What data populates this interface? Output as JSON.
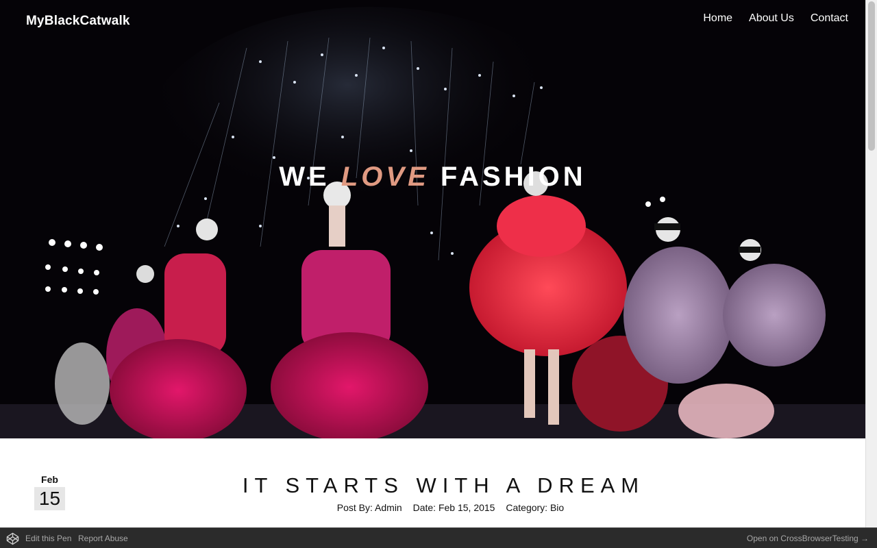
{
  "header": {
    "logo": "MyBlackCatwalk",
    "nav": [
      {
        "label": "Home"
      },
      {
        "label": "About Us"
      },
      {
        "label": "Contact"
      }
    ]
  },
  "hero": {
    "title_part1": "WE",
    "title_accent": "LOVE",
    "title_part2": "FASHION",
    "accent_color": "#e09a82"
  },
  "post": {
    "date_month": "Feb",
    "date_day": "15",
    "title": "IT STARTS WITH A DREAM",
    "meta": {
      "author": "Post By: Admin",
      "date": "Date: Feb 15, 2015",
      "category": "Category: Bio"
    }
  },
  "footer": {
    "edit_label": "Edit this Pen",
    "report_label": "Report Abuse",
    "cbt_label": "Open on CrossBrowserTesting →"
  },
  "icons": {
    "codepen": "codepen-icon"
  }
}
